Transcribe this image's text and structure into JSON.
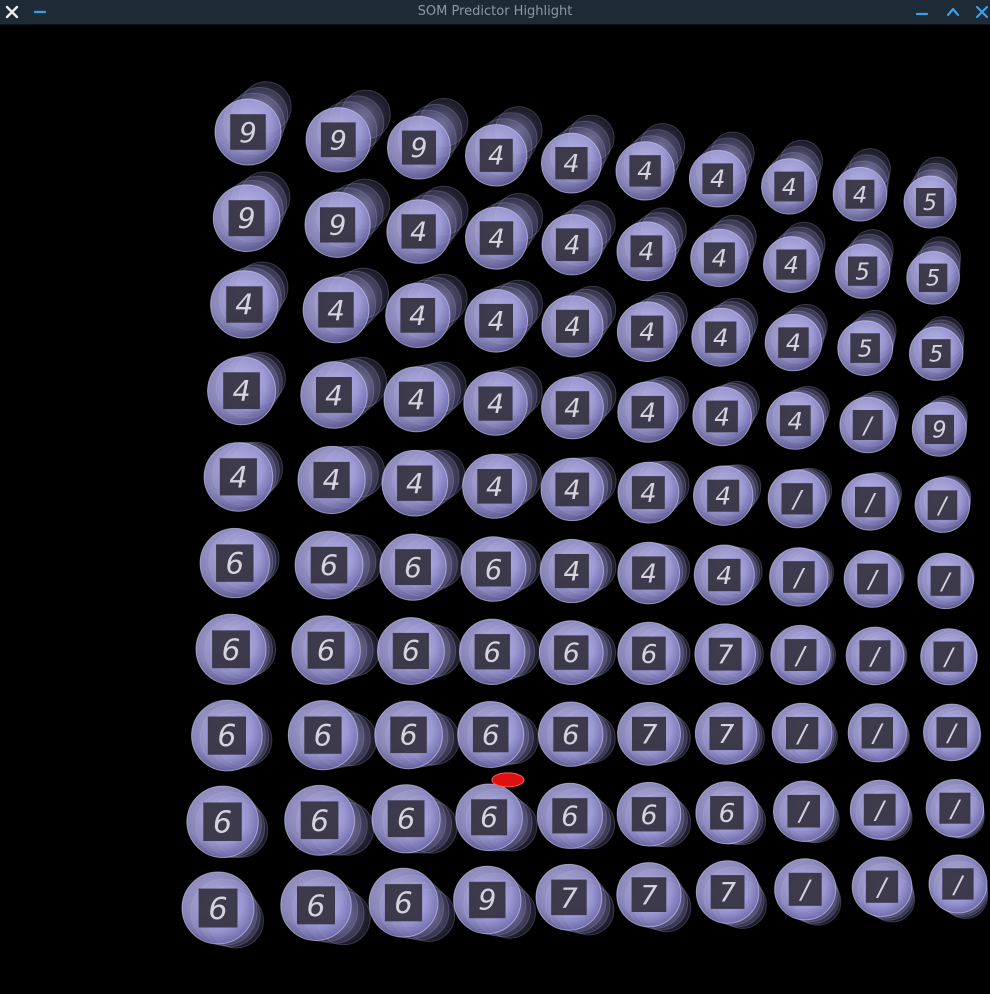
{
  "window": {
    "title": "SOM Predictor Highlight",
    "close_icon": "close-icon",
    "minimize_left_icon": "minimize-icon",
    "minimize_icon": "minimize-icon",
    "maximize_icon": "chevron-up-icon",
    "close_right_icon": "close-icon"
  },
  "colors": {
    "titlebar": "#1e2a36",
    "accent": "#3d9ee9",
    "sphere": "#a9a6e6",
    "tile": "#33313f",
    "digit": "#e4e4ee",
    "highlight": "#e01010",
    "background": "#000000"
  },
  "som_grid": {
    "rows": [
      [
        "9",
        "9",
        "9",
        "4",
        "4",
        "4",
        "4",
        "4",
        "4",
        "5"
      ],
      [
        "9",
        "9",
        "4",
        "4",
        "4",
        "4",
        "4",
        "4",
        "5",
        "5"
      ],
      [
        "4",
        "4",
        "4",
        "4",
        "4",
        "4",
        "4",
        "4",
        "5",
        "5"
      ],
      [
        "4",
        "4",
        "4",
        "4",
        "4",
        "4",
        "4",
        "4",
        "/",
        "9"
      ],
      [
        "4",
        "4",
        "4",
        "4",
        "4",
        "4",
        "4",
        "/",
        "/",
        "/"
      ],
      [
        "6",
        "6",
        "6",
        "6",
        "4",
        "4",
        "4",
        "/",
        "/",
        "/"
      ],
      [
        "6",
        "6",
        "6",
        "6",
        "6",
        "6",
        "7",
        "/",
        "/",
        "/"
      ],
      [
        "6",
        "6",
        "6",
        "6",
        "6",
        "7",
        "7",
        "/",
        "/",
        "/"
      ],
      [
        "6",
        "6",
        "6",
        "6",
        "6",
        "6",
        "6",
        "/",
        "/",
        "/"
      ],
      [
        "6",
        "6",
        "6",
        "9",
        "7",
        "7",
        "7",
        "/",
        "/",
        "/"
      ]
    ],
    "highlight_icon": "highlight-marker-icon"
  }
}
